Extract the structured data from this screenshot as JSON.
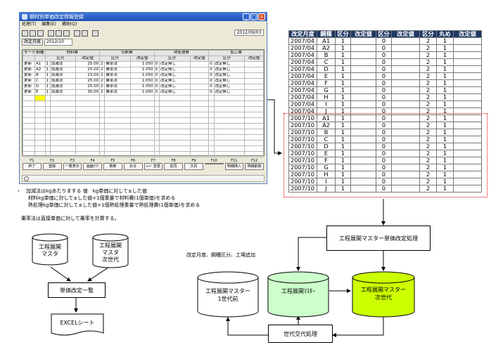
{
  "window": {
    "title": "鋼材別単価改定情報登録",
    "menu": [
      "処理(T)",
      "編集(E)",
      "補助(Q)"
    ],
    "date": "2012/09/03",
    "revision_label": "改定月度",
    "revision_value": "2012/10",
    "columns_top": [
      "モード",
      "鋼種",
      "材料費",
      "",
      "切断費",
      "",
      "熱処理費",
      "",
      "加工費",
      ""
    ],
    "columns_sub": [
      "",
      "",
      "区分",
      "改定値",
      "区分",
      "改定値",
      "区分",
      "改定値",
      "区分",
      "改定値"
    ],
    "rows": [
      [
        "更新",
        "A1",
        "1",
        "加減法",
        "25.00",
        "2",
        "乗率法",
        "1.050",
        "0",
        "改定無し",
        "0",
        "改定無し"
      ],
      [
        "更新",
        "A2",
        "1",
        "加減法",
        "25.00",
        "2",
        "乗率法",
        "1.050",
        "0",
        "改定無し",
        "0",
        "改定無し"
      ],
      [
        "更新",
        "B",
        "1",
        "加減法",
        "23.00",
        "2",
        "乗率法",
        "1.050",
        "0",
        "改定無し",
        "0",
        "改定無し"
      ],
      [
        "更新",
        "C",
        "1",
        "加減法",
        "25.00",
        "2",
        "乗率法",
        "1.050",
        "0",
        "改定無し",
        "0",
        "改定無し"
      ],
      [
        "更新",
        "D",
        "1",
        "加減法",
        "25.00",
        "2",
        "乗率法",
        "1.050",
        "0",
        "改定無し",
        "0",
        "改定無し"
      ],
      [
        "更新",
        "E",
        "1",
        "加減法",
        "30.00",
        "2",
        "乗率法",
        "1.050",
        "0",
        "改定無し",
        "0",
        "改定無し"
      ]
    ],
    "fkeys": [
      {
        "n": "F1",
        "b": "終了"
      },
      {
        "n": "F2",
        "b": "登録"
      },
      {
        "n": "F3",
        "b": "一覧表示"
      },
      {
        "n": "F4",
        "b": "画面ｸﾘｱ"
      },
      {
        "n": "F5",
        "b": "検索"
      },
      {
        "n": "F6",
        "b": "戻る"
      },
      {
        "n": "F7",
        "b": "ﾓｰﾄﾞ変更"
      },
      {
        "n": "F8",
        "b": "前頁"
      },
      {
        "n": "F9",
        "b": "次頁"
      },
      {
        "n": "F10",
        "b": ""
      },
      {
        "n": "F11",
        "b": "明細挿入"
      },
      {
        "n": "F12",
        "b": "明細削除"
      }
    ]
  },
  "notes": {
    "line1": "・　加減法はkgあたりまする 値　kg単価に対して±した値",
    "line2": "材料kg単価に対して±した値×1個重量で材料費(1個単価)を求める",
    "line3": "熱処理kg単価に対して±した値×1個熱処理重量で熱処理費(1個単価)を求める",
    "line4": "乗率法は直接単価に対して乗率を計算する。",
    "line5": "改定月度、鋼種区分、工場追加"
  },
  "right_table": {
    "headers": [
      "改定月度",
      "鋼種",
      "区分",
      "改定値",
      "区分",
      "改定値",
      "区分",
      "丸め",
      "改定値"
    ],
    "rows": [
      [
        "2007/04",
        "A1",
        "1",
        "",
        "0",
        "",
        "2",
        "1",
        ""
      ],
      [
        "2007/04",
        "A2",
        "1",
        "",
        "0",
        "",
        "2",
        "1",
        ""
      ],
      [
        "2007/04",
        "B",
        "1",
        "",
        "0",
        "",
        "2",
        "1",
        ""
      ],
      [
        "2007/04",
        "C",
        "1",
        "",
        "0",
        "",
        "2",
        "1",
        ""
      ],
      [
        "2007/04",
        "D",
        "1",
        "",
        "0",
        "",
        "2",
        "1",
        ""
      ],
      [
        "2007/04",
        "E",
        "1",
        "",
        "0",
        "",
        "2",
        "1",
        ""
      ],
      [
        "2007/04",
        "F",
        "1",
        "",
        "0",
        "",
        "2",
        "1",
        ""
      ],
      [
        "2007/04",
        "G",
        "1",
        "",
        "0",
        "",
        "2",
        "1",
        ""
      ],
      [
        "2007/04",
        "H",
        "1",
        "",
        "0",
        "",
        "2",
        "1",
        ""
      ],
      [
        "2007/04",
        "I",
        "1",
        "",
        "0",
        "",
        "2",
        "1",
        ""
      ],
      [
        "2007/04",
        "J",
        "1",
        "",
        "0",
        "",
        "2",
        "1",
        ""
      ],
      [
        "2007/10",
        "A1",
        "1",
        "",
        "0",
        "",
        "2",
        "1",
        ""
      ],
      [
        "2007/10",
        "A2",
        "1",
        "",
        "0",
        "",
        "2",
        "1",
        ""
      ],
      [
        "2007/10",
        "B",
        "1",
        "",
        "0",
        "",
        "2",
        "1",
        ""
      ],
      [
        "2007/10",
        "C",
        "1",
        "",
        "0",
        "",
        "2",
        "1",
        ""
      ],
      [
        "2007/10",
        "D",
        "1",
        "",
        "0",
        "",
        "2",
        "1",
        ""
      ],
      [
        "2007/10",
        "E",
        "1",
        "",
        "0",
        "",
        "2",
        "1",
        ""
      ],
      [
        "2007/10",
        "F",
        "1",
        "",
        "0",
        "",
        "2",
        "1",
        ""
      ],
      [
        "2007/10",
        "G",
        "1",
        "",
        "0",
        "",
        "2",
        "1",
        ""
      ],
      [
        "2007/10",
        "H",
        "1",
        "",
        "0",
        "",
        "2",
        "1",
        ""
      ],
      [
        "2007/10",
        "I",
        "1",
        "",
        "0",
        "",
        "2",
        "1",
        ""
      ],
      [
        "2007/10",
        "J",
        "1",
        "",
        "0",
        "",
        "2",
        "1",
        ""
      ]
    ]
  },
  "flow_left": {
    "db1": [
      "工程展開",
      "マスタ"
    ],
    "db2": [
      "工程展開",
      "マスタ",
      "次世代"
    ],
    "list_box": "単価改定一覧",
    "excel": "EXCELシート"
  },
  "flow_right": {
    "process_box": "工程展開マスター単価改定処理",
    "db_prev": [
      "工程展開マスター",
      "1世代前"
    ],
    "db_cur": [
      "工程展開ﾏｽﾀｰ"
    ],
    "db_next": [
      "工程展開マスター",
      "次世代"
    ],
    "swap_box": "世代交代処理"
  },
  "colors": {
    "titlebar": "#1e4fb5",
    "header_bg": "#1f3864",
    "cyl_cur": "#ccffcc",
    "cyl_next": "#ccff00",
    "dotted_border": "#dd0000"
  }
}
